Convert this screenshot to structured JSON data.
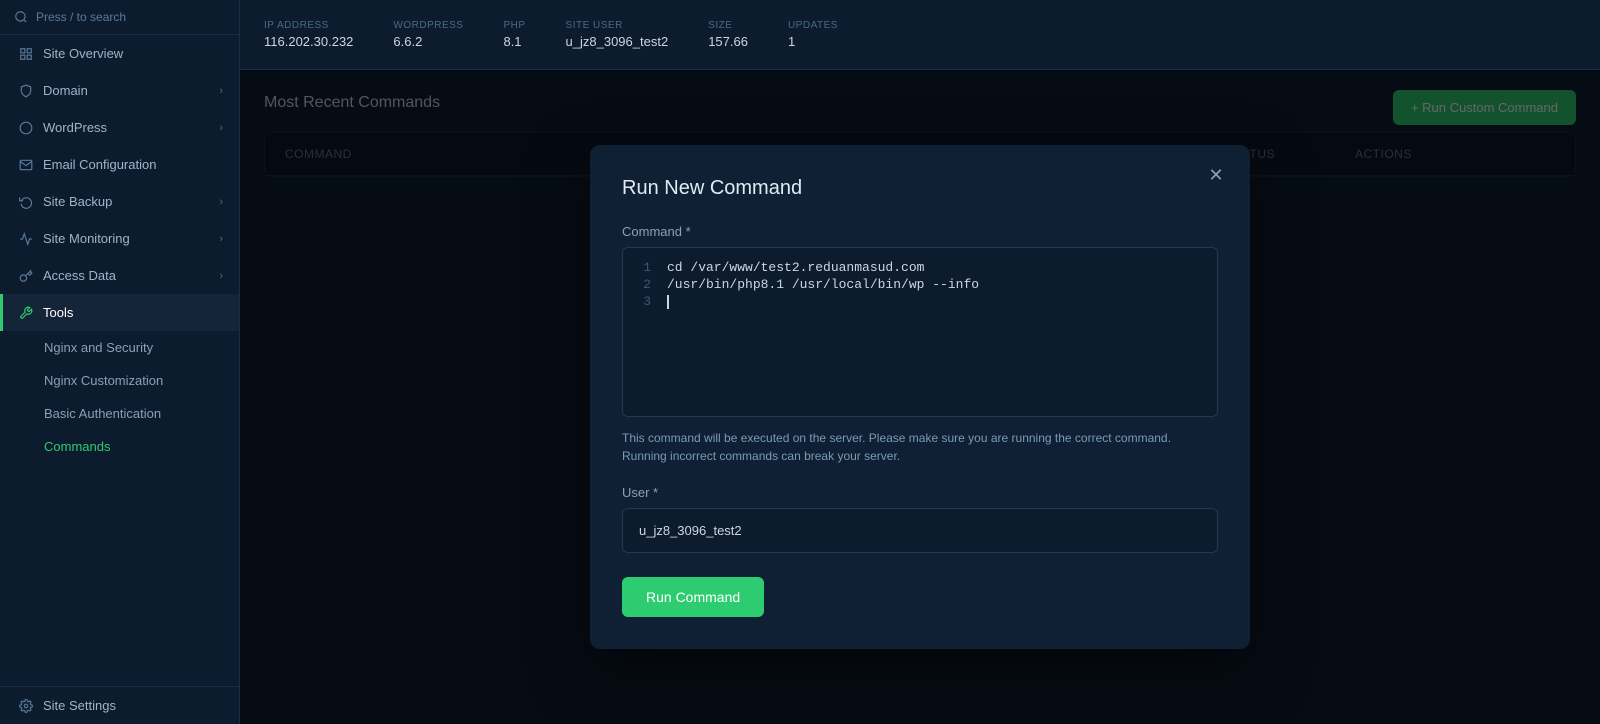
{
  "sidebar": {
    "search_placeholder": "Press / to search",
    "items": [
      {
        "id": "site-overview",
        "label": "Site Overview",
        "icon": "grid-icon",
        "has_chevron": false
      },
      {
        "id": "domain",
        "label": "Domain",
        "icon": "shield-icon",
        "has_chevron": true
      },
      {
        "id": "wordpress",
        "label": "WordPress",
        "icon": "wordpress-icon",
        "has_chevron": true
      },
      {
        "id": "email-configuration",
        "label": "Email Configuration",
        "icon": "email-icon",
        "has_chevron": false
      },
      {
        "id": "site-backup",
        "label": "Site Backup",
        "icon": "backup-icon",
        "has_chevron": true
      },
      {
        "id": "site-monitoring",
        "label": "Site Monitoring",
        "icon": "monitoring-icon",
        "has_chevron": true
      },
      {
        "id": "access-data",
        "label": "Access Data",
        "icon": "access-icon",
        "has_chevron": true
      },
      {
        "id": "tools",
        "label": "Tools",
        "icon": "tools-icon",
        "has_chevron": false,
        "active": true
      }
    ],
    "sub_items": [
      {
        "id": "nginx-security",
        "label": "Nginx and Security"
      },
      {
        "id": "nginx-customization",
        "label": "Nginx Customization"
      },
      {
        "id": "basic-auth",
        "label": "Basic Authentication"
      },
      {
        "id": "commands",
        "label": "Commands",
        "active": true
      }
    ],
    "bottom_items": [
      {
        "id": "site-settings",
        "label": "Site Settings",
        "icon": "gear-icon"
      }
    ]
  },
  "topbar": {
    "columns": [
      {
        "label": "IP ADDRESS",
        "value": "116.202.30.232"
      },
      {
        "label": "WORDPRESS",
        "value": "6.6.2"
      },
      {
        "label": "PHP",
        "value": "8.1"
      },
      {
        "label": "SITE USER",
        "value": "u_jz8_3096_test2"
      },
      {
        "label": "SIZE",
        "value": "157.66"
      },
      {
        "label": "UPDATES",
        "value": "1"
      }
    ]
  },
  "main": {
    "section_title": "Most Recent Commands",
    "run_custom_btn": "+ Run Custom Command",
    "table_headers": [
      "Command",
      "Status",
      "Actions"
    ]
  },
  "modal": {
    "title": "Run New Command",
    "command_label": "Command *",
    "code_lines": [
      {
        "num": "1",
        "code": "cd /var/www/test2.reduanmasud.com"
      },
      {
        "num": "2",
        "code": "/usr/bin/php8.1 /usr/local/bin/wp --info"
      },
      {
        "num": "3",
        "code": ""
      }
    ],
    "warning_text": "This command will be executed on the server. Please make sure you are running the correct command. Running incorrect commands can break your server.",
    "user_label": "User *",
    "user_value": "u_jz8_3096_test2",
    "run_btn_label": "Run Command"
  },
  "colors": {
    "accent_green": "#2ecc71",
    "bg_dark": "#0d1b2e",
    "bg_medium": "#0f2035"
  }
}
